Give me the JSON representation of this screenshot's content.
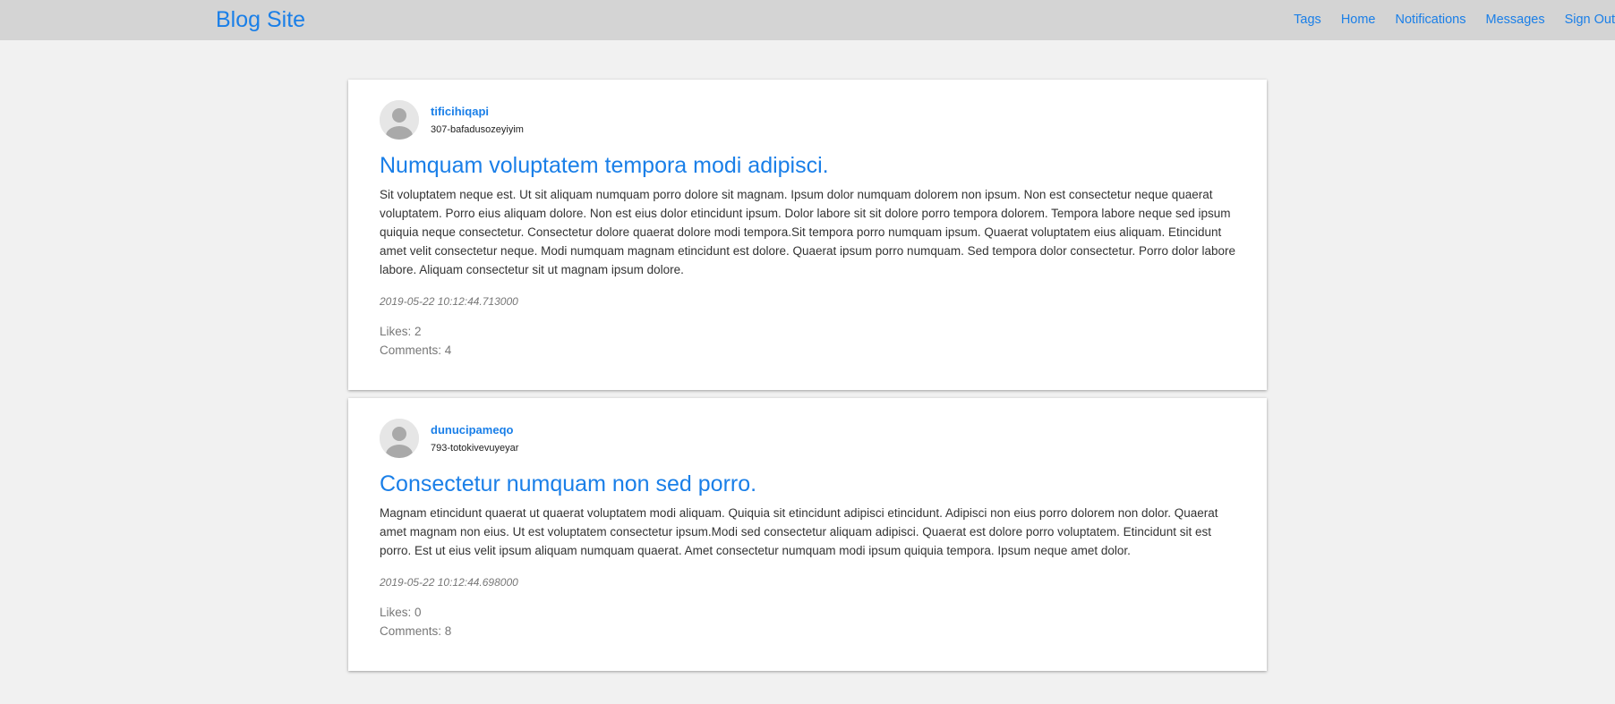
{
  "brand": "Blog Site",
  "nav": [
    "Tags",
    "Home",
    "Notifications",
    "Messages",
    "Sign Out"
  ],
  "posts": [
    {
      "author": "tificihiqapi",
      "handle": "307-bafadusozeyiyim",
      "title": "Numquam voluptatem tempora modi adipisci.",
      "body": "Sit voluptatem neque est. Ut sit aliquam numquam porro dolore sit magnam. Ipsum dolor numquam dolorem non ipsum. Non est consectetur neque quaerat voluptatem. Porro eius aliquam dolore. Non est eius dolor etincidunt ipsum. Dolor labore sit sit dolore porro tempora dolorem. Tempora labore neque sed ipsum quiquia neque consectetur. Consectetur dolore quaerat dolore modi tempora.Sit tempora porro numquam ipsum. Quaerat voluptatem eius aliquam. Etincidunt amet velit consectetur neque. Modi numquam magnam etincidunt est dolore. Quaerat ipsum porro numquam. Sed tempora dolor consectetur. Porro dolor labore labore. Aliquam consectetur sit ut magnam ipsum dolore.",
      "date": "2019-05-22 10:12:44.713000",
      "likes": "Likes: 2",
      "comments": "Comments: 4"
    },
    {
      "author": "dunucipameqo",
      "handle": "793-totokivevuyeyar",
      "title": "Consectetur numquam non sed porro.",
      "body": "Magnam etincidunt quaerat ut quaerat voluptatem modi aliquam. Quiquia sit etincidunt adipisci etincidunt. Adipisci non eius porro dolorem non dolor. Quaerat amet magnam non eius. Ut est voluptatem consectetur ipsum.Modi sed consectetur aliquam adipisci. Quaerat est dolore porro voluptatem. Etincidunt sit est porro. Est ut eius velit ipsum aliquam numquam quaerat. Amet consectetur numquam modi ipsum quiquia tempora. Ipsum neque amet dolor.",
      "date": "2019-05-22 10:12:44.698000",
      "likes": "Likes: 0",
      "comments": "Comments: 8"
    }
  ]
}
